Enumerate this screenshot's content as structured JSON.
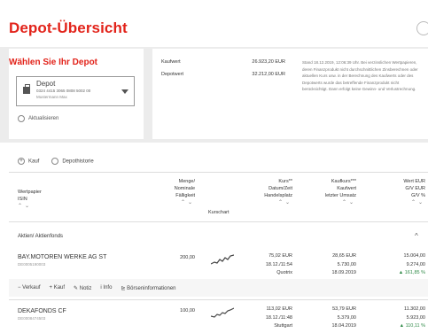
{
  "page": {
    "title": "Depot-Übersicht"
  },
  "depot_select": {
    "heading": "Wählen Sie Ihr Depot",
    "label": "Depot",
    "number": "0324 4415 3065 0808 5002 00",
    "owner": "Mustermann Max",
    "refresh_label": "Aktualisieren"
  },
  "summary": {
    "kaufwert_label": "Kaufwert",
    "kaufwert_value": "26.923,20 EUR",
    "depotwert_label": "Depotwert",
    "depotwert_value": "32.212,00 EUR",
    "info": "Stand 18.12.2019, 12:06:39 Uhr. Bei verzinslichen Wertpapieren, deren Finanzprodukt nicht durchschnittlichen Zinsberechnen oder aktuellen Kurs usw. in der Berechnung des Kaufwerts oder des Depotwerts wurde das betreffende Finanzprodukt nicht berücksichtigt. Dann erfolgt keine Gewinn- und Verlustrechnung."
  },
  "actions": {
    "kauf": "Kauf",
    "historie": "Depothistorie"
  },
  "table": {
    "headers": {
      "wertpapier": "Wertpapier",
      "isin": "ISIN",
      "menge": "Menge/",
      "nominale": "Nominale",
      "faelligkeit": "Fälligkeit",
      "kurschart": "Kurschart",
      "kurs": "Kurs**",
      "datum": "Datum/Zeit",
      "handelsplatz": "Handelsplatz",
      "kaufkurs": "Kaufkurs***",
      "kaufwert": "Kaufwert",
      "letzter": "letzter Umsatz",
      "wert": "Wert EUR",
      "gv_eur": "G/V EUR",
      "gv_pct": "G/V %"
    },
    "section": "Aktien/ Aktienfonds",
    "rows": [
      {
        "name": "BAY.MOTOREN WERKE AG ST",
        "isin": "DE0005190003",
        "menge": "200,00",
        "kurs": "75,02 EUR",
        "datum": "18.12./11:54",
        "platz": "Quotrix",
        "kaufkurs": "28,65 EUR",
        "kaufwert": "5.730,00",
        "umsatz": "18.09.2019",
        "wert": "15.004,00",
        "gv": "9.274,00",
        "gvp": "161,85 %"
      },
      {
        "name": "DEKAFONDS CF",
        "isin": "DE0008474503",
        "menge": "100,00",
        "kurs": "113,02 EUR",
        "datum": "18.12./11:48",
        "platz": "Stuttgart",
        "kaufkurs": "53,79 EUR",
        "kaufwert": "5.379,00",
        "umsatz": "18.04.2019",
        "wert": "11.302,00",
        "gv": "5.923,00",
        "gvp": "110,11 %"
      }
    ],
    "row_actions": {
      "verkauf": "Verkauf",
      "kauf": "Kauf",
      "notiz": "Notiz",
      "info": "Info",
      "boerse": "Börseninformationen"
    }
  },
  "colors": {
    "brand_red": "#e2231a",
    "gain_green": "#2f8a47"
  }
}
